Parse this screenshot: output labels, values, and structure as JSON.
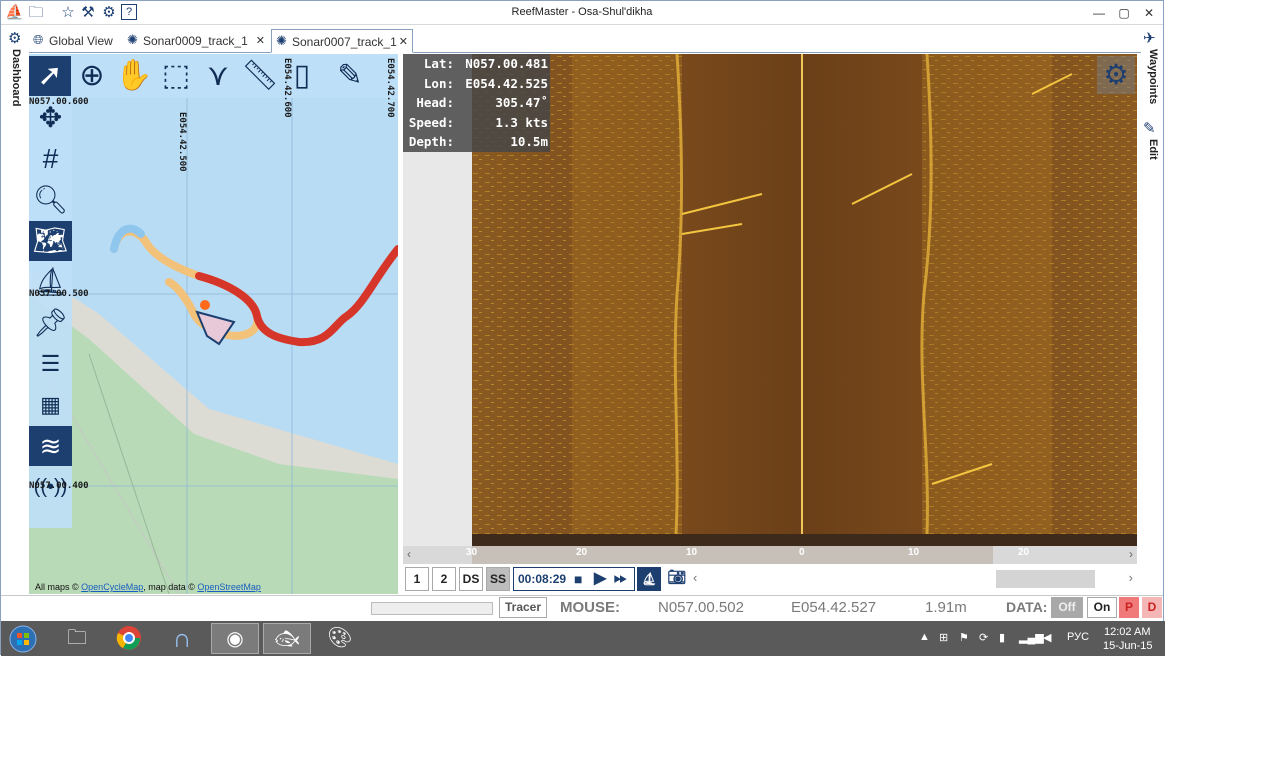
{
  "window": {
    "title": "ReefMaster - Osa-Shul'dikha"
  },
  "toolbar_icons": [
    "ship-icon",
    "folder-icon",
    "star-icon",
    "tools-icon",
    "gear-icon",
    "help-icon"
  ],
  "tabs": [
    {
      "label": "Global View",
      "icon": "globe-icon",
      "closable": false,
      "active": false
    },
    {
      "label": "Sonar0009_track_1",
      "icon": "sonar-icon",
      "closable": true,
      "active": false
    },
    {
      "label": "Sonar0007_track_1",
      "icon": "sonar-icon",
      "closable": true,
      "active": true
    }
  ],
  "side_left": {
    "label": "Dashboard"
  },
  "side_right": {
    "waypoints": "Waypoints",
    "edit": "Edit"
  },
  "map": {
    "grid_labels": {
      "lon1": "E054.42.500",
      "lon2": "E054.42.600",
      "lon3": "E054.42.700",
      "lat_top": "N057.00.600",
      "lat_mid": "N057.00.500",
      "lat_bottom": "N057.00.400"
    },
    "credit": {
      "prefix": "All maps ©",
      "osm_cycle": "OpenCycleMap",
      "middle": ", map data ©",
      "osm": "OpenStreetMap"
    }
  },
  "sonar_info": {
    "lat_label": "Lat:",
    "lat": "N057.00.481",
    "lon_label": "Lon:",
    "lon": "E054.42.525",
    "head_label": "Head:",
    "head": "305.47˚",
    "speed_label": "Speed:",
    "speed": "1.3 kts",
    "depth_label": "Depth:",
    "depth": "10.5m"
  },
  "scale_labels": [
    "30",
    "20",
    "10",
    "0",
    "10",
    "20"
  ],
  "controls": {
    "btn1": "1",
    "btn2": "2",
    "ds": "DS",
    "ss": "SS",
    "time": "00:08:29"
  },
  "status": {
    "tracer": "Tracer",
    "mouse_label": "MOUSE:",
    "mouse_lat": "N057.00.502",
    "mouse_lon": "E054.42.527",
    "distance": "1.91m",
    "data_label": "DATA:",
    "off": "Off",
    "on": "On",
    "p": "P",
    "d": "D"
  },
  "taskbar": {
    "lang": "РУС",
    "time": "12:02 AM",
    "date": "15-Jun-15"
  }
}
